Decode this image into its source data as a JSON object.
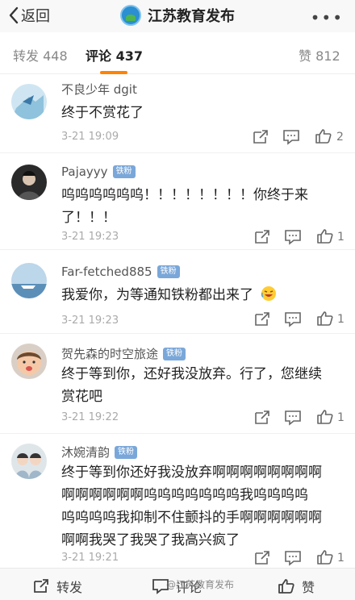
{
  "header": {
    "back_label": "返回",
    "title": "江苏教育发布",
    "more": "•••"
  },
  "tabs": [
    {
      "label": "转发 448"
    },
    {
      "label": "评论 437"
    },
    {
      "label": "赞 812"
    }
  ],
  "comments": [
    {
      "name": "不良少年 dgit",
      "badge": "",
      "lines": [
        "终于不赏花了"
      ],
      "time": "3-21 19:09",
      "likes": "2"
    },
    {
      "name": "Pajayyy",
      "badge": "铁粉",
      "lines": [
        "呜呜呜呜呜呜！！！！！！！！你终于来",
        "了！！！"
      ],
      "time": "3-21 19:23",
      "likes": "1"
    },
    {
      "name": "Far-fetched885",
      "badge": "铁粉",
      "lines": [
        "我爱你，为等通知铁粉都出来了"
      ],
      "time": "3-21 19:23",
      "likes": "1"
    },
    {
      "name": "贺先森的时空旅途",
      "badge": "铁粉",
      "lines": [
        "终于等到你，还好我没放弃。行了，您继续",
        "赏花吧"
      ],
      "time": "3-21 19:22",
      "likes": "1"
    },
    {
      "name": "沐婉清韵",
      "badge": "铁粉",
      "lines": [
        "终于等到你还好我没放弃啊啊啊啊啊啊啊啊",
        "啊啊啊啊啊啊呜呜呜呜呜呜呜我呜呜呜呜",
        "呜呜呜呜我抑制不住颤抖的手啊啊啊啊啊啊",
        "啊啊我哭了我哭了我高兴疯了"
      ],
      "time": "3-21 19:21",
      "likes": "1"
    }
  ],
  "bottom": {
    "repost": "转发",
    "comment": "评论",
    "like": "赞"
  },
  "watermark": "@江苏教育发布",
  "colors": {
    "accent": "#ff8200",
    "badge": "#7aa7d9"
  }
}
